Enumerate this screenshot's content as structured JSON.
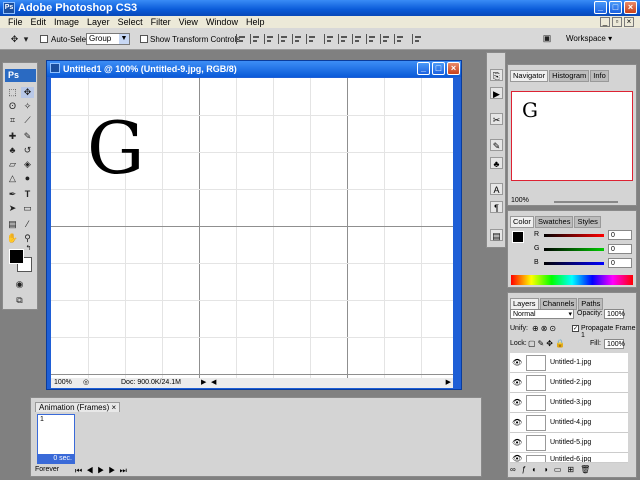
{
  "window": {
    "title": "Adobe Photoshop CS3",
    "app_icon": "Ps"
  },
  "menu": [
    "File",
    "Edit",
    "Image",
    "Layer",
    "Select",
    "Filter",
    "View",
    "Window",
    "Help"
  ],
  "options_bar": {
    "auto_select_label": "Auto-Select:",
    "auto_select_value": "Group",
    "show_transform_label": "Show Transform Controls",
    "workspace_label": "Workspace ▾"
  },
  "tools": {
    "logo": "Ps"
  },
  "document": {
    "title": "Untitled1 @ 100% (Untitled-9.jpg, RGB/8)",
    "letter": "G",
    "zoom": "100%",
    "doc_size": "Doc: 900.0K/24.1M"
  },
  "animation": {
    "tab": "Animation (Frames)",
    "frame_label": "1",
    "frame_time": "0 sec.",
    "loop": "Forever"
  },
  "navigator": {
    "tabs": [
      "Navigator",
      "Histogram",
      "Info"
    ],
    "preview_letter": "G",
    "zoom": "100%"
  },
  "color": {
    "tabs": [
      "Color",
      "Swatches",
      "Styles"
    ],
    "channels": [
      {
        "label": "R",
        "value": "0",
        "color": "#d00000"
      },
      {
        "label": "G",
        "value": "0",
        "color": "#00a000"
      },
      {
        "label": "B",
        "value": "0",
        "color": "#0000d0"
      }
    ]
  },
  "layers": {
    "tabs": [
      "Layers",
      "Channels",
      "Paths"
    ],
    "blend_mode": "Normal",
    "opacity_label": "Opacity:",
    "opacity": "100%",
    "unify_label": "Unify:",
    "propagate_label": "Propagate Frame 1",
    "lock_label": "Lock:",
    "fill_label": "Fill:",
    "fill": "100%",
    "items": [
      {
        "name": "Untitled-1.jpg"
      },
      {
        "name": "Untitled-2.jpg"
      },
      {
        "name": "Untitled-3.jpg"
      },
      {
        "name": "Untitled-4.jpg"
      },
      {
        "name": "Untitled-5.jpg"
      },
      {
        "name": "Untitled-6.jpg"
      }
    ]
  }
}
